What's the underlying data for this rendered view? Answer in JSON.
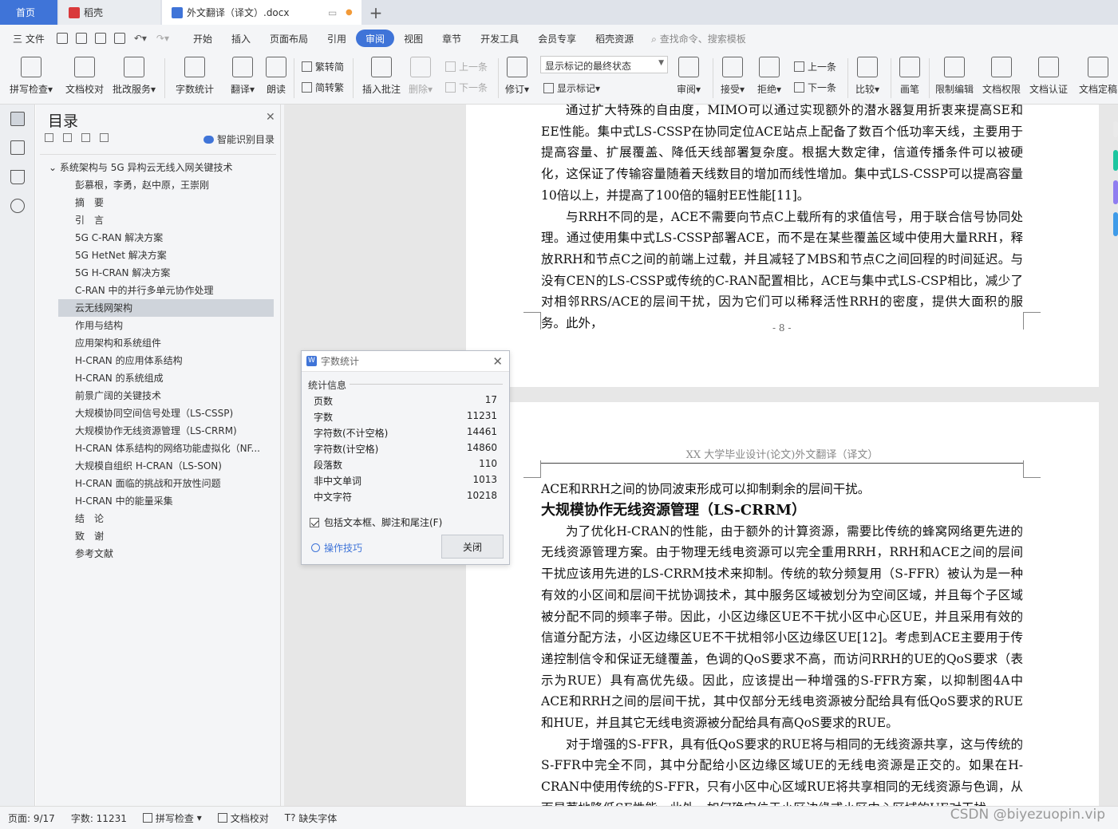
{
  "tabs": {
    "home": "首页",
    "shell": "稻壳",
    "doc": "外文翻译（译文）.docx"
  },
  "menu": {
    "file": "三 文件",
    "tabs": [
      "开始",
      "插入",
      "页面布局",
      "引用",
      "审阅",
      "视图",
      "章节",
      "开发工具",
      "会员专享",
      "稻壳资源"
    ],
    "active": "审阅",
    "search": "查找命令、搜索模板"
  },
  "ribbon": {
    "spell": "拼写检查",
    "proof": "文档校对",
    "batch": "批改服务",
    "wordcount": "字数统计",
    "translate": "翻译",
    "read": "朗读",
    "trad": "繁转简",
    "simp": "简转繁",
    "comment": "插入批注",
    "delete": "删除",
    "prev_c": "上一条",
    "next_c": "下一条",
    "revise": "修订",
    "markup_state": "显示标记的最终状态",
    "show_markup": "显示标记",
    "review": "审阅",
    "accept": "接受",
    "reject": "拒绝",
    "prev_r": "上一条",
    "next_r": "下一条",
    "compare": "比较",
    "pen": "画笔",
    "restrict": "限制编辑",
    "perm": "文档权限",
    "cert": "文档认证",
    "final": "文档定稿"
  },
  "toc": {
    "title": "目录",
    "smart": "智能识别目录",
    "items": [
      {
        "label": "系统架构与 5G 异构云无线入网关键技术",
        "level": 0
      },
      {
        "label": "彭慕根，李勇，赵中原，王崇刚",
        "level": 1
      },
      {
        "label": "摘　要",
        "level": 1
      },
      {
        "label": "引　言",
        "level": 1
      },
      {
        "label": "5G C-RAN 解决方案",
        "level": 1
      },
      {
        "label": "5G HetNet 解决方案",
        "level": 1
      },
      {
        "label": "5G H-CRAN 解决方案",
        "level": 1
      },
      {
        "label": "C-RAN 中的并行多单元协作处理",
        "level": 1
      },
      {
        "label": "云无线网架构",
        "level": 1,
        "selected": true
      },
      {
        "label": "作用与结构",
        "level": 1
      },
      {
        "label": "应用架构和系统组件",
        "level": 1
      },
      {
        "label": "H-CRAN 的应用体系结构",
        "level": 1
      },
      {
        "label": "H-CRAN 的系统组成",
        "level": 1
      },
      {
        "label": "前景广阔的关键技术",
        "level": 1
      },
      {
        "label": "大规模协同空间信号处理（LS-CSSP)",
        "level": 1
      },
      {
        "label": "大规模协作无线资源管理（LS-CRRM)",
        "level": 1
      },
      {
        "label": "H-CRAN 体系结构的网络功能虚拟化（NF...",
        "level": 1
      },
      {
        "label": "大规模自组织 H-CRAN（LS-SON)",
        "level": 1
      },
      {
        "label": "H-CRAN 面临的挑战和开放性问题",
        "level": 1
      },
      {
        "label": "H-CRAN 中的能量采集",
        "level": 1
      },
      {
        "label": "结　论",
        "level": 1
      },
      {
        "label": "致　谢",
        "level": 1
      },
      {
        "label": "参考文献",
        "level": 1
      }
    ]
  },
  "page1": {
    "p1": "通过扩大特殊的自由度，MIMO可以通过实现额外的潜水器复用折衷来提高SE和EE性能。集中式LS-CSSP在协同定位ACE站点上配备了数百个低功率天线，主要用于提高容量、扩展覆盖、降低天线部署复杂度。根据大数定律，信道传播条件可以被硬化，这保证了传输容量随着天线数目的增加而线性增加。集中式LS-CSSP可以提高容量10倍以上，并提高了100倍的辐射EE性能[11]。",
    "p2": "与RRH不同的是，ACE不需要向节点C上载所有的求值信号，用于联合信号协同处理。通过使用集中式LS-CSSP部署ACE，而不是在某些覆盖区域中使用大量RRH，释放RRH和节点C之间的前端上过载，并且减轻了MBS和节点C之间回程的时间延迟。与没有CEN的LS-CSSP或传统的C-RAN配置相比，ACE与集中式LS-CSP相比，减少了对相邻RRS/ACE的层间干扰，因为它们可以稀释活性RRH的密度，提供大面积的服务。此外，",
    "pagenum": "- 8 -"
  },
  "page2": {
    "header": "XX 大学毕业设计(论文)外文翻译（译文）",
    "p0": "ACE和RRH之间的协同波束形成可以抑制剩余的层间干扰。",
    "heading": "大规模协作无线资源管理（LS-CRRM）",
    "p1": "为了优化H-CRAN的性能，由于额外的计算资源，需要比传统的蜂窝网络更先进的无线资源管理方案。由于物理无线电资源可以完全重用RRH，RRH和ACE之间的层间干扰应该用先进的LS-CRRM技术来抑制。传统的软分频复用（S-FFR）被认为是一种有效的小区间和层间干扰协调技术，其中服务区域被划分为空间区域，并且每个子区域被分配不同的频率子带。因此，小区边缘区UE不干扰小区中心区UE，并且采用有效的信道分配方法，小区边缘区UE不干扰相邻小区边缘区UE[12]。考虑到ACE主要用于传递控制信令和保证无缝覆盖，色调的QoS要求不高，而访问RRH的UE的QoS要求（表示为RUE）具有高优先级。因此，应该提出一种增强的S-FFR方案，以抑制图4A中ACE和RRH之间的层间干扰，其中仅部分无线电资源被分配给具有低QoS要求的RUE和HUE，并且其它无线电资源被分配给具有高QoS要求的RUE。",
    "p2": "对于增强的S-FFR，具有低QoS要求的RUE将与相同的无线资源共享，这与传统的S-FFR中完全不同，其中分配给小区边缘区域UE的无线电资源是正交的。如果在H-CRAN中使用传统的S-FFR，只有小区中心区域RUE将共享相同的无线资源与色调，从而显著地降低SE性能。此外，如何确定位于小区边缘或小区中心区域的UE对干扰"
  },
  "dialog": {
    "title": "字数统计",
    "section": "统计信息",
    "rows": [
      {
        "k": "页数",
        "v": "17"
      },
      {
        "k": "字数",
        "v": "11231"
      },
      {
        "k": "字符数(不计空格)",
        "v": "14461"
      },
      {
        "k": "字符数(计空格)",
        "v": "14860"
      },
      {
        "k": "段落数",
        "v": "110"
      },
      {
        "k": "非中文单词",
        "v": "1013"
      },
      {
        "k": "中文字符",
        "v": "10218"
      }
    ],
    "checkbox": "包括文本框、脚注和尾注(F)",
    "tips": "操作技巧",
    "close": "关闭"
  },
  "status": {
    "page": "页面: 9/17",
    "words": "字数: 11231",
    "spell": "拼写检查",
    "proof": "文档校对",
    "font": "缺失字体"
  },
  "watermark": "CSDN @biyezuopin.vip",
  "colors": {
    "accent": "#3f74d8"
  }
}
